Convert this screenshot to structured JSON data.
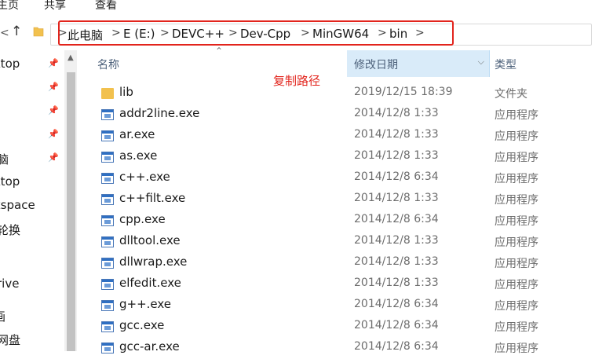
{
  "ribbon": {
    "tabs": [
      "主页",
      "共享",
      "查看"
    ]
  },
  "address": {
    "crumbs": [
      "此电脑",
      "E (E:)",
      "DEVC++",
      "Dev-Cpp",
      "MinGW64",
      "bin"
    ],
    "separator": ">",
    "highlight_color": "#e2241c"
  },
  "nav": {
    "back_glyph": "<",
    "up_glyph": "↑",
    "pin_glyph": "📌",
    "items": [
      "ktop",
      "脑",
      "ktop",
      "kspace",
      "轮换",
      "rive",
      "画",
      "网盘"
    ]
  },
  "columns": {
    "name": "名称",
    "date": "修改日期",
    "type": "类型"
  },
  "annotation": "复制路径",
  "files": [
    {
      "name": "lib",
      "date": "2019/12/15 18:39",
      "type": "文件夹",
      "icon": "folder-icon"
    },
    {
      "name": "addr2line.exe",
      "date": "2014/12/8 1:33",
      "type": "应用程序",
      "icon": "exe-icon"
    },
    {
      "name": "ar.exe",
      "date": "2014/12/8 1:33",
      "type": "应用程序",
      "icon": "exe-icon"
    },
    {
      "name": "as.exe",
      "date": "2014/12/8 1:33",
      "type": "应用程序",
      "icon": "exe-icon"
    },
    {
      "name": "c++.exe",
      "date": "2014/12/8 6:34",
      "type": "应用程序",
      "icon": "exe-icon"
    },
    {
      "name": "c++filt.exe",
      "date": "2014/12/8 1:33",
      "type": "应用程序",
      "icon": "exe-icon"
    },
    {
      "name": "cpp.exe",
      "date": "2014/12/8 6:34",
      "type": "应用程序",
      "icon": "exe-icon"
    },
    {
      "name": "dlltool.exe",
      "date": "2014/12/8 1:33",
      "type": "应用程序",
      "icon": "exe-icon"
    },
    {
      "name": "dllwrap.exe",
      "date": "2014/12/8 1:33",
      "type": "应用程序",
      "icon": "exe-icon"
    },
    {
      "name": "elfedit.exe",
      "date": "2014/12/8 1:33",
      "type": "应用程序",
      "icon": "exe-icon"
    },
    {
      "name": "g++.exe",
      "date": "2014/12/8 6:34",
      "type": "应用程序",
      "icon": "exe-icon"
    },
    {
      "name": "gcc.exe",
      "date": "2014/12/8 6:34",
      "type": "应用程序",
      "icon": "exe-icon"
    },
    {
      "name": "gcc-ar.exe",
      "date": "2014/12/8 6:34",
      "type": "应用程序",
      "icon": "exe-icon"
    }
  ]
}
